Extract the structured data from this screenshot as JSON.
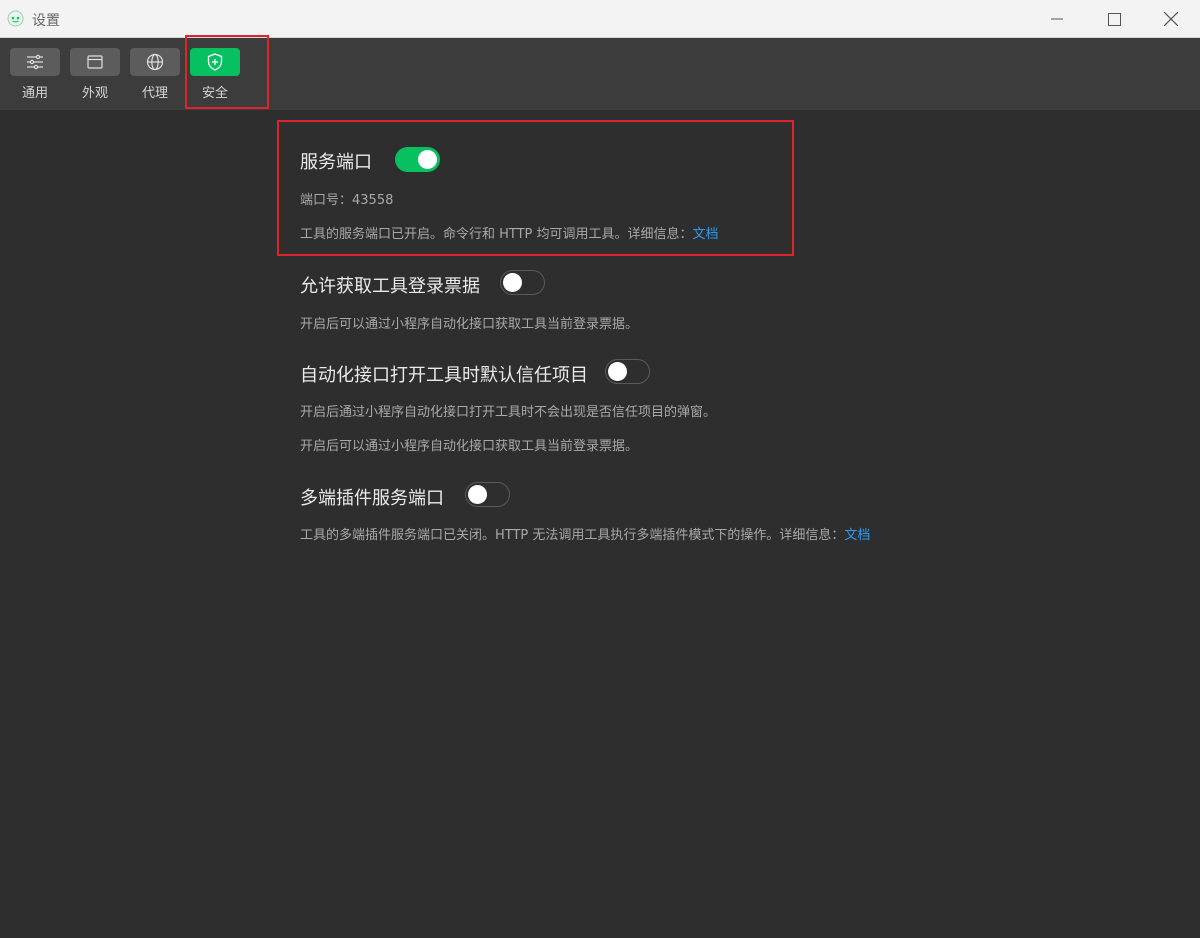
{
  "window": {
    "title": "设置"
  },
  "tabs": [
    {
      "label": "通用",
      "icon": "sliders-icon",
      "active": false
    },
    {
      "label": "外观",
      "icon": "window-icon",
      "active": false
    },
    {
      "label": "代理",
      "icon": "globe-icon",
      "active": false
    },
    {
      "label": "安全",
      "icon": "shield-icon",
      "active": true
    }
  ],
  "settings": {
    "service_port": {
      "title": "服务端口",
      "enabled": true,
      "port_label": "端口号：43558",
      "desc": "工具的服务端口已开启。命令行和 HTTP 均可调用工具。详细信息：",
      "link": "文档"
    },
    "login_ticket": {
      "title": "允许获取工具登录票据",
      "enabled": false,
      "desc": "开启后可以通过小程序自动化接口获取工具当前登录票据。"
    },
    "auto_trust": {
      "title": "自动化接口打开工具时默认信任项目",
      "enabled": false,
      "desc1": "开启后通过小程序自动化接口打开工具时不会出现是否信任项目的弹窗。",
      "desc2": "开启后可以通过小程序自动化接口获取工具当前登录票据。"
    },
    "multi_plugin": {
      "title": "多端插件服务端口",
      "enabled": false,
      "desc": "工具的多端插件服务端口已关闭。HTTP 无法调用工具执行多端插件模式下的操作。详细信息：",
      "link": "文档"
    }
  },
  "colors": {
    "accent": "#07c160",
    "link": "#2f9bf0",
    "highlight": "#e0242c",
    "background": "#2e2e2e",
    "toolbar": "#3c3c3c"
  }
}
